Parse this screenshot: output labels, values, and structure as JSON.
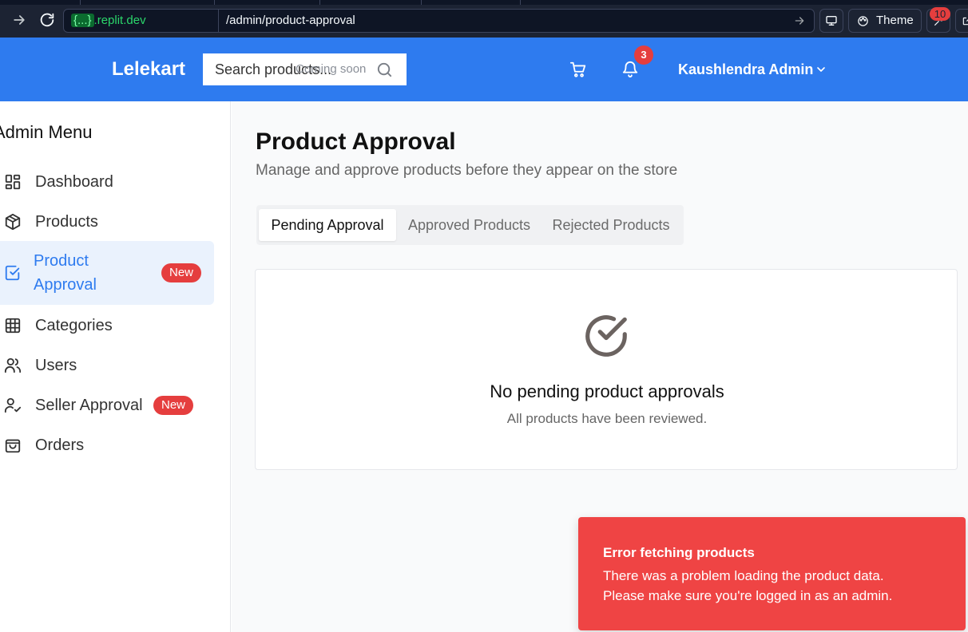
{
  "browser": {
    "domain_braces": "{...}",
    "domain_rest": ".replit.dev",
    "path": "/admin/product-approval",
    "theme_label": "Theme",
    "notification_count": "10"
  },
  "header": {
    "brand": "Lelekart",
    "search_placeholder": "Search products...",
    "search_hint": "Coming soon",
    "notification_badge": "3",
    "user_name": "Kaushlendra Admin"
  },
  "sidebar": {
    "title": "Admin Menu",
    "items": [
      {
        "label": "Dashboard",
        "icon": "dashboard-icon"
      },
      {
        "label": "Products",
        "icon": "package-icon"
      },
      {
        "label": "Product Approval",
        "icon": "checkbox-icon",
        "badge": "New",
        "active": true
      },
      {
        "label": "Categories",
        "icon": "grid-icon"
      },
      {
        "label": "Users",
        "icon": "users-icon"
      },
      {
        "label": "Seller Approval",
        "icon": "user-check-icon",
        "badge": "New"
      },
      {
        "label": "Orders",
        "icon": "shopping-bag-icon"
      }
    ]
  },
  "main": {
    "title": "Product Approval",
    "subtitle": "Manage and approve products before they appear on the store",
    "tabs": [
      {
        "label": "Pending Approval",
        "active": true
      },
      {
        "label": "Approved Products"
      },
      {
        "label": "Rejected Products"
      }
    ],
    "empty_state": {
      "icon": "check-circle-icon",
      "title": "No pending product approvals",
      "text": "All products have been reviewed."
    }
  },
  "toast": {
    "title": "Error fetching products",
    "line1": "There was a problem loading the product data.",
    "line2": "Please make sure you're logged in as an admin."
  },
  "colors": {
    "header_bg": "#2e7bef",
    "accent": "#2e7bef",
    "badge_red": "#e53e3e",
    "toast_bg": "#ef4444",
    "browser_bg": "#1c2333"
  }
}
